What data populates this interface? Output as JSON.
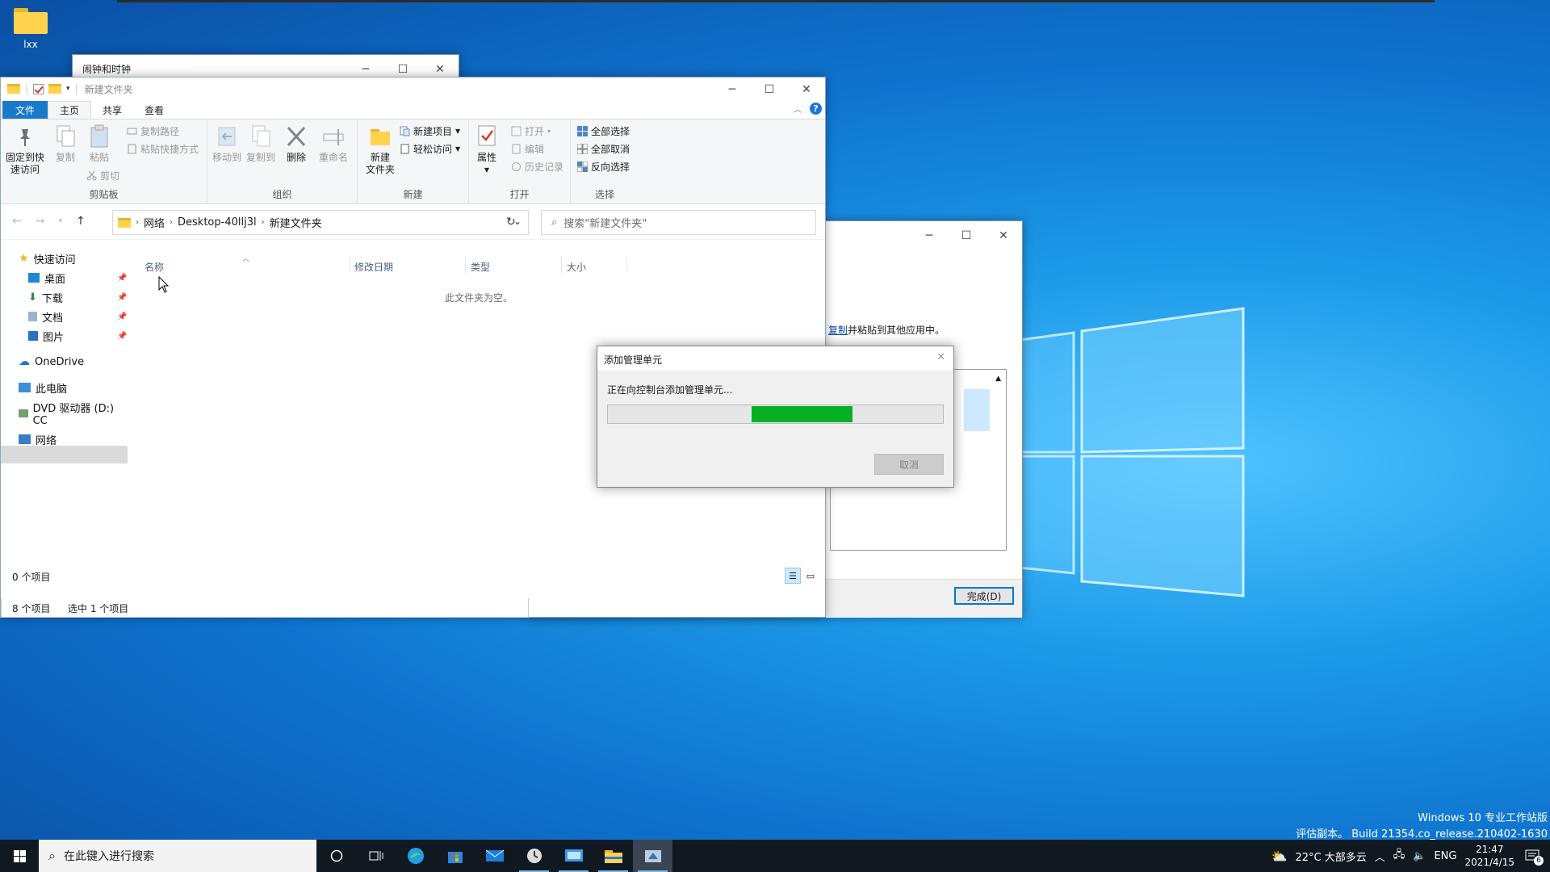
{
  "desktop": {
    "icon_label": "lxx",
    "watermark_line1": "Windows 10 专业工作站版",
    "watermark_line2": "评估副本。 Build 21354.co_release.210402-1630"
  },
  "clock_window": {
    "title": "闹钟和时钟"
  },
  "wizard_window": {
    "link_prefix": "复制",
    "link_suffix": "并粘贴到其他应用中。",
    "done_button": "完成(D)"
  },
  "explorer": {
    "title": "新建文件夹",
    "tabs": {
      "file": "文件",
      "home": "主页",
      "share": "共享",
      "view": "查看"
    },
    "ribbon": {
      "clipboard": {
        "label": "剪贴板",
        "pin": "固定到快\n速访问",
        "pin_l1": "固定到快",
        "pin_l2": "速访问",
        "copy": "复制",
        "paste": "粘贴",
        "copy_path": "复制路径",
        "paste_shortcut": "粘贴快捷方式",
        "cut": "剪切"
      },
      "organize": {
        "label": "组织",
        "move_to": "移动到",
        "copy_to": "复制到",
        "delete": "删除",
        "rename": "重命名"
      },
      "new": {
        "label": "新建",
        "new_folder_l1": "新建",
        "new_folder_l2": "文件夹",
        "new_item": "新建项目",
        "easy_access": "轻松访问"
      },
      "open": {
        "label": "打开",
        "properties": "属性",
        "open": "打开",
        "edit": "编辑",
        "history": "历史记录"
      },
      "select": {
        "label": "选择",
        "select_all": "全部选择",
        "select_none": "全部取消",
        "invert": "反向选择"
      }
    },
    "address": {
      "crumbs": [
        "网络",
        "Desktop-40llj3l",
        "新建文件夹"
      ]
    },
    "search_placeholder": "搜索\"新建文件夹\"",
    "nav": {
      "quick_access": "快速访问",
      "desktop": "桌面",
      "downloads": "下载",
      "documents": "文档",
      "pictures": "图片",
      "onedrive": "OneDrive",
      "this_pc": "此电脑",
      "dvd": "DVD 驱动器 (D:) CC",
      "network": "网络"
    },
    "columns": {
      "name": "名称",
      "modified": "修改日期",
      "type": "类型",
      "size": "大小"
    },
    "empty_text": "此文件夹为空。",
    "status_count": "0 个项目",
    "status2_count": "8 个项目",
    "status2_selected": "选中 1 个项目"
  },
  "progress_dialog": {
    "title": "添加管理单元",
    "message": "正在向控制台添加管理单元...",
    "progress_start": 0.43,
    "progress_end": 0.73,
    "cancel": "取消"
  },
  "taskbar": {
    "search_placeholder": "在此键入进行搜索",
    "weather": "22°C 大部多云",
    "lang": "ENG",
    "time": "21:47",
    "date": "2021/4/15",
    "notifications": "6"
  },
  "colors": {
    "accent": "#0078d7",
    "progress": "#06b025",
    "file_tab": "#1979ca"
  }
}
